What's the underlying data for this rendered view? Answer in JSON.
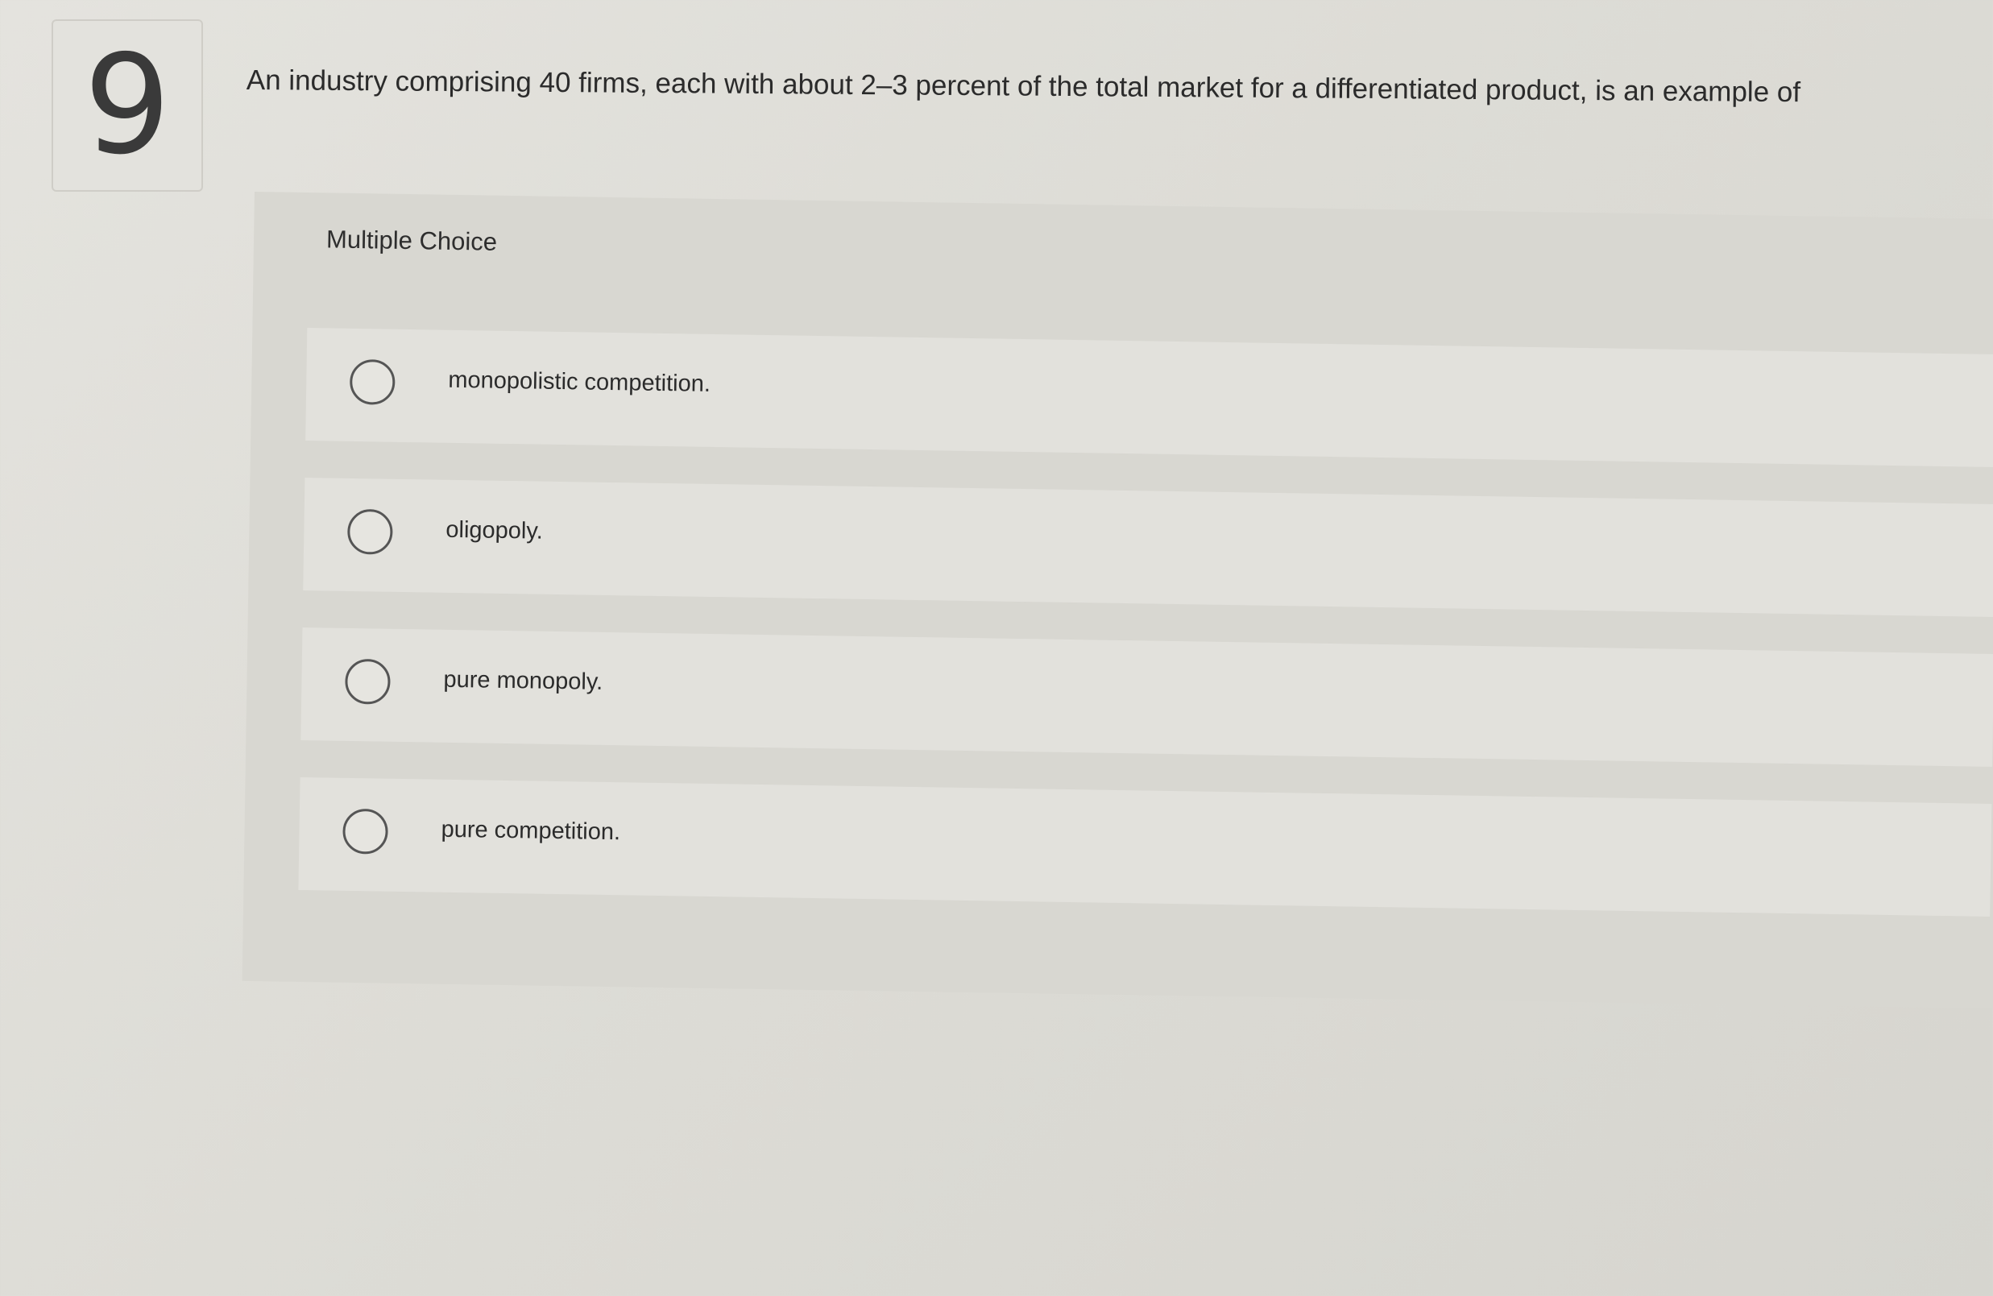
{
  "question": {
    "number": "9",
    "text": "An industry comprising 40 firms, each with about 2–3 percent of the total market for a differentiated product, is an example of"
  },
  "choices": {
    "header": "Multiple Choice",
    "options": [
      {
        "label": "monopolistic competition."
      },
      {
        "label": "oligopoly."
      },
      {
        "label": "pure monopoly."
      },
      {
        "label": "pure competition."
      }
    ]
  }
}
